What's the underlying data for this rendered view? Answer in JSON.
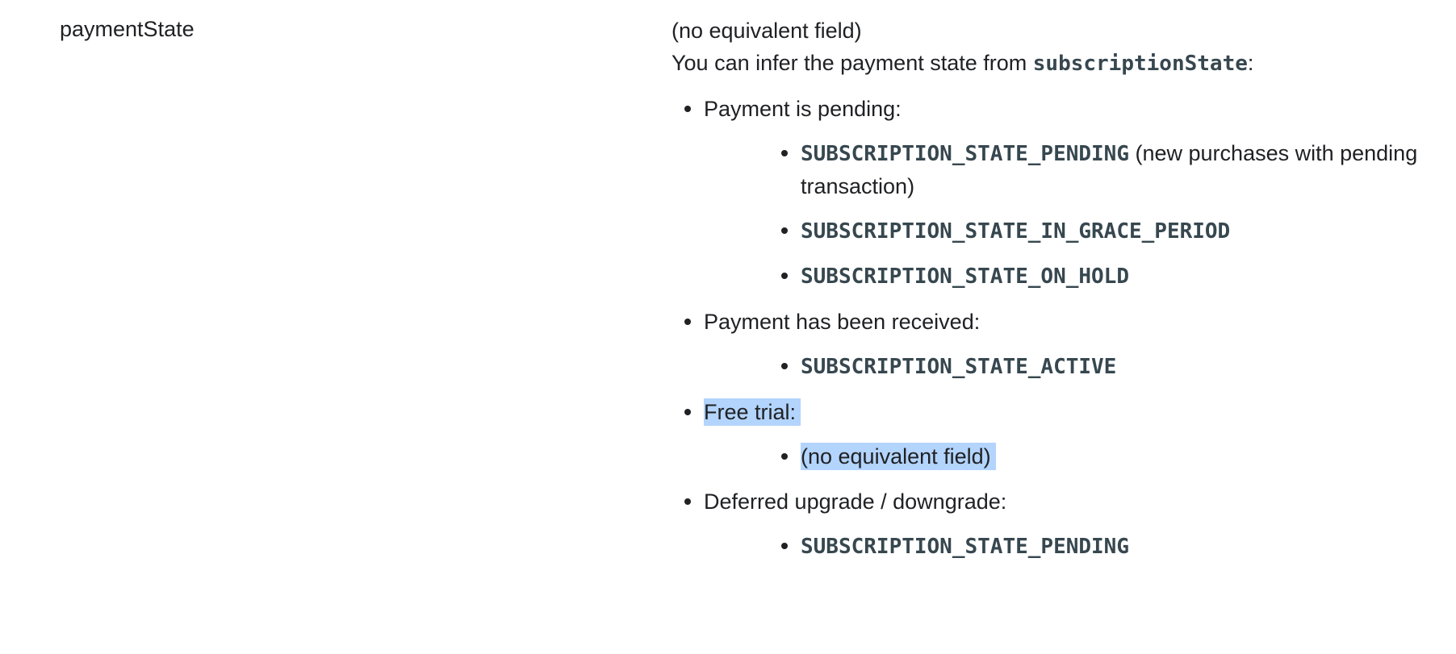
{
  "field": {
    "name": "paymentState",
    "equivalent": "(no equivalent field)",
    "intro_text": "You can infer the payment state from ",
    "intro_code": "subscriptionState",
    "intro_suffix": ":"
  },
  "groups": [
    {
      "label": "Payment is pending:",
      "highlighted": false,
      "items": [
        {
          "code": "SUBSCRIPTION_STATE_PENDING",
          "text": " (new purchases with pending transaction)"
        },
        {
          "code": "SUBSCRIPTION_STATE_IN_GRACE_PERIOD",
          "text": ""
        },
        {
          "code": "SUBSCRIPTION_STATE_ON_HOLD",
          "text": ""
        }
      ]
    },
    {
      "label": "Payment has been received:",
      "highlighted": false,
      "items": [
        {
          "code": "SUBSCRIPTION_STATE_ACTIVE",
          "text": ""
        }
      ]
    },
    {
      "label": "Free trial:",
      "highlighted": true,
      "items": [
        {
          "code": "",
          "text": "(no equivalent field)"
        }
      ]
    },
    {
      "label": "Deferred upgrade / downgrade:",
      "highlighted": false,
      "items": [
        {
          "code": "SUBSCRIPTION_STATE_PENDING",
          "text": ""
        }
      ]
    }
  ],
  "colors": {
    "text": "#202124",
    "code": "#37474f",
    "selection": "#b3d4fc"
  }
}
